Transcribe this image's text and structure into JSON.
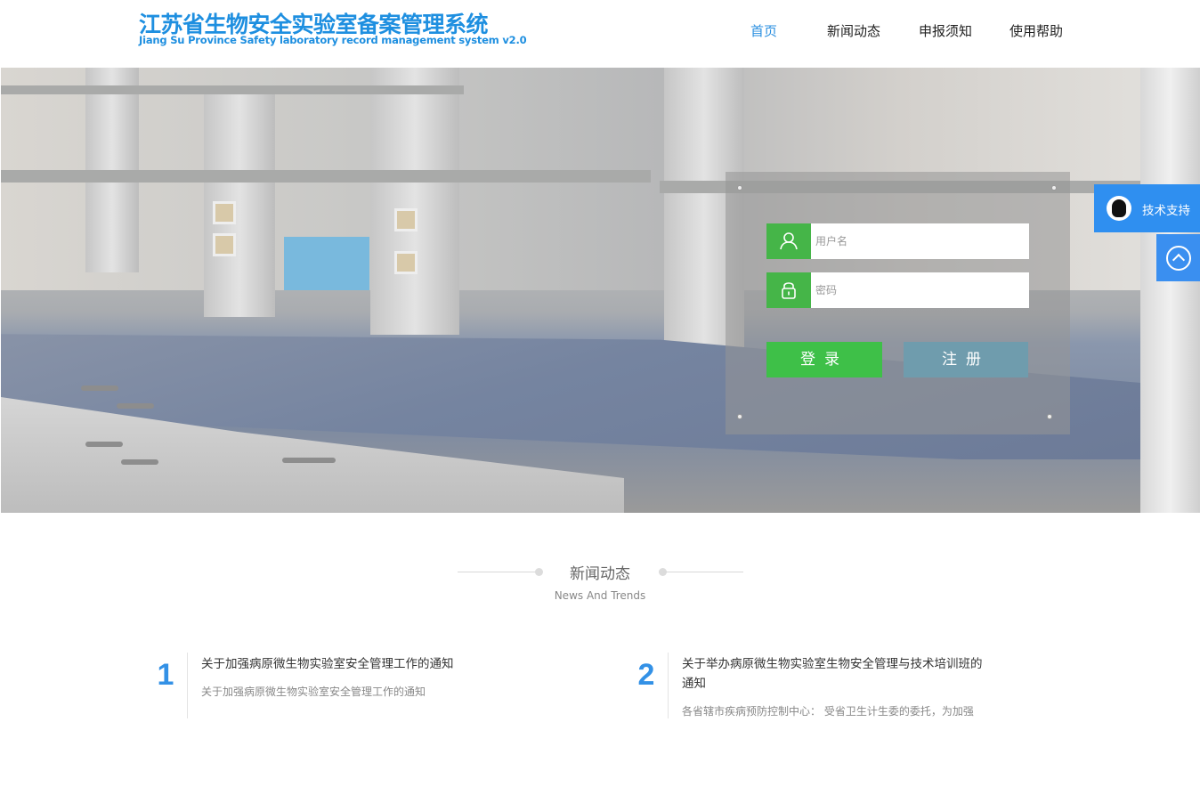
{
  "header": {
    "title": "江苏省生物安全实验室备案管理系统",
    "subtitle": "Jiang Su Province Safety laboratory record management system v2.0"
  },
  "nav": {
    "items": [
      {
        "label": "首页",
        "active": true
      },
      {
        "label": "新闻动态",
        "active": false
      },
      {
        "label": "申报须知",
        "active": false
      },
      {
        "label": "使用帮助",
        "active": false
      }
    ]
  },
  "login": {
    "username_placeholder": "用户名",
    "password_placeholder": "密码",
    "login_label": "登录",
    "register_label": "注册",
    "username_icon": "user-icon",
    "password_icon": "lock-icon"
  },
  "side": {
    "support_label": "技术支持",
    "support_icon": "qq-icon",
    "top_icon": "chevron-up-icon"
  },
  "news": {
    "title": "新闻动态",
    "subtitle": "News And Trends",
    "items": [
      {
        "number": "1",
        "title": "关于加强病原微生物实验室安全管理工作的通知",
        "desc": "关于加强病原微生物实验室安全管理工作的通知"
      },
      {
        "number": "2",
        "title": "关于举办病原微生物实验室生物安全管理与技术培训班的通知",
        "desc": "各省辖市疾病预防控制中心： 受省卫生计生委的委托，为加强"
      }
    ]
  },
  "colors": {
    "brand": "#1e8fe0",
    "nav_active": "#2a8fe0",
    "login_green": "#3ec048",
    "register_blue": "#6f9cad",
    "support_blue": "#2f8ff0"
  }
}
